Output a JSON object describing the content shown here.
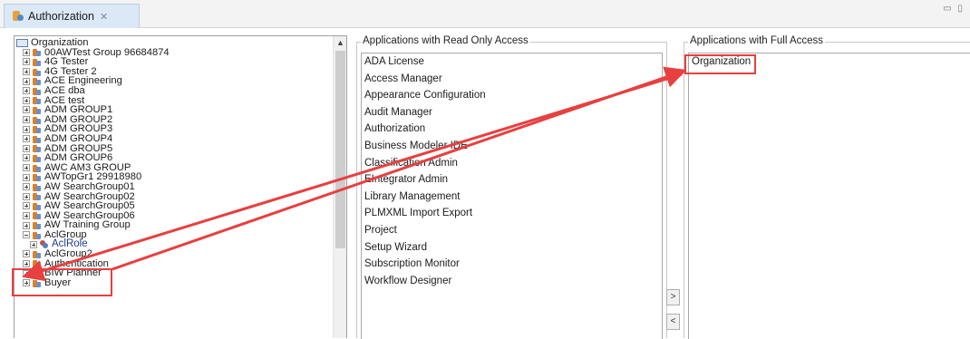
{
  "tab": {
    "label": "Authorization",
    "close_glyph": "✕",
    "window_controls": "▭ ▯"
  },
  "tree": {
    "root_label": "Organization",
    "items": [
      "00AWTest Group 96684874",
      "4G Tester",
      "4G Tester 2",
      "ACE Engineering",
      "ACE dba",
      "ACE test",
      "ADM GROUP1",
      "ADM GROUP2",
      "ADM GROUP3",
      "ADM GROUP4",
      "ADM GROUP5",
      "ADM GROUP6",
      "AWC AM3 GROUP",
      "AWTopGr1 29918980",
      "AW SearchGroup01",
      "AW SearchGroup02",
      "AW SearchGroup05",
      "AW SearchGroup06",
      "AW Training Group"
    ],
    "expanded_group": "AclGroup",
    "role_child": "AclRole",
    "items_after": [
      "AclGroup2",
      "Authentication",
      "BIW Planner",
      "Buyer"
    ],
    "scroll_up_glyph": "▲"
  },
  "read_only": {
    "title": "Applications with Read Only Access",
    "items": [
      "ADA License",
      "Access Manager",
      "Appearance Configuration",
      "Audit Manager",
      "Authorization",
      "Business Modeler IDE",
      "Classification Admin",
      "EIntegrator Admin",
      "Library Management",
      "PLMXML Import Export",
      "Project",
      "Setup Wizard",
      "Subscription Monitor",
      "Workflow Designer"
    ]
  },
  "full_access": {
    "title": "Applications with Full Access",
    "items": [
      "Organization"
    ]
  },
  "buttons": {
    "move_right": ">",
    "move_left": "<"
  },
  "colors": {
    "highlight": "#e83f3f",
    "tab_bg": "#dbe9f7"
  }
}
